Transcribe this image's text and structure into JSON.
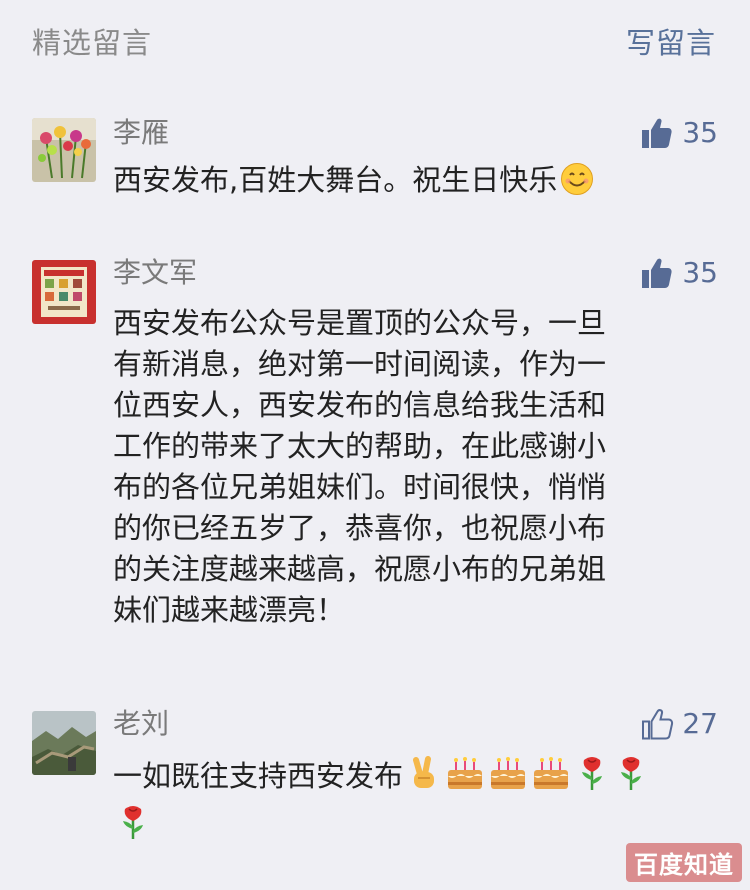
{
  "header": {
    "title": "精选留言",
    "action": "写留言"
  },
  "comments": [
    {
      "nickname": "李雁",
      "likes": "35",
      "liked": true,
      "avatar": "flower-bouquet",
      "lines": [
        "西安发布,百姓大舞台。祝生日快乐"
      ],
      "emoji": [
        "smiling-face"
      ]
    },
    {
      "nickname": "李文军",
      "likes": "35",
      "liked": true,
      "avatar": "red-book-cover",
      "lines": [
        "西安发布公众号是置顶的公众号，一旦",
        "有新消息，绝对第一时间阅读，作为一",
        "位西安人，西安发布的信息给我生活和",
        "工作的带来了太大的帮助，在此感谢小",
        "布的各位兄弟姐妹们。时间很快，悄悄",
        "的你已经五岁了，恭喜你，也祝愿小布",
        "的关注度越来越高，祝愿小布的兄弟姐",
        "妹们越来越漂亮！"
      ]
    },
    {
      "nickname": "老刘",
      "likes": "27",
      "liked": false,
      "avatar": "great-wall-photo",
      "lines": [
        "一如既往支持西安发布"
      ],
      "emoji": [
        "victory-hand",
        "birthday-cake",
        "birthday-cake",
        "birthday-cake",
        "rose",
        "rose",
        "rose"
      ]
    }
  ],
  "watermark": "百度知道",
  "colors": {
    "background": "#efeff4",
    "link": "#576b95",
    "nickname": "#7a7a7a",
    "text": "#222222"
  }
}
